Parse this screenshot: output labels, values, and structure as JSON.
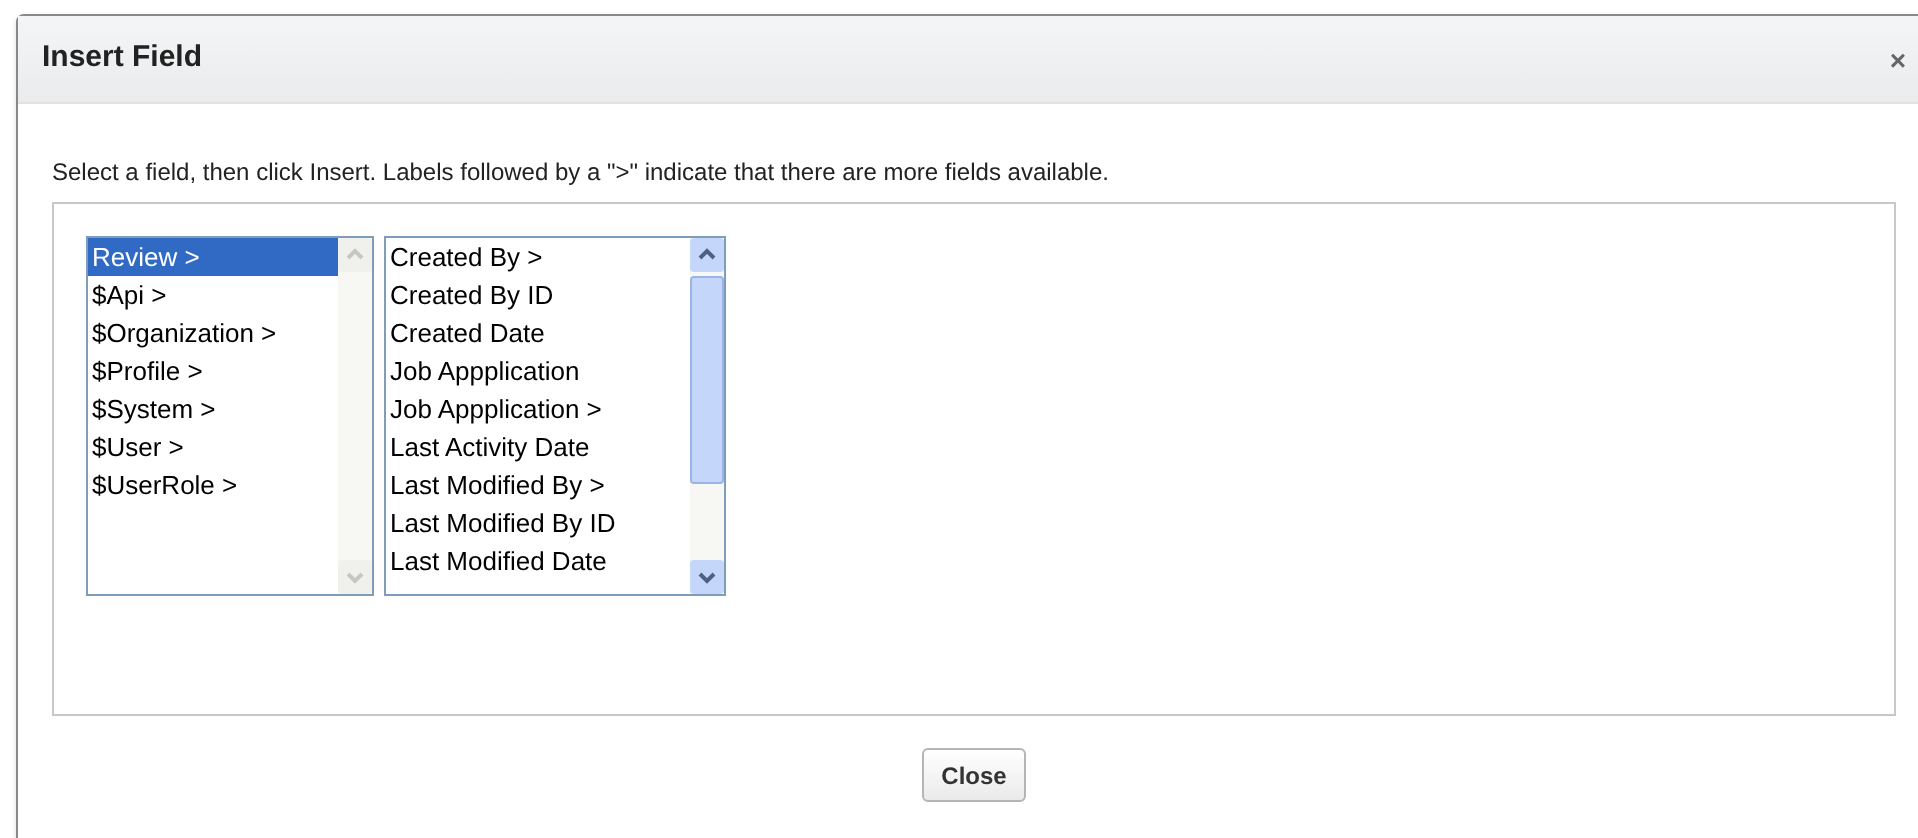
{
  "dialog": {
    "title": "Insert Field",
    "close_icon": "×"
  },
  "instructions": "Select a field, then click Insert. Labels followed by a \">\" indicate that there are more fields available.",
  "lists": [
    {
      "scrollable": false,
      "items": [
        {
          "label": "Review >",
          "selected": true
        },
        {
          "label": "$Api >",
          "selected": false
        },
        {
          "label": "$Organization >",
          "selected": false
        },
        {
          "label": "$Profile >",
          "selected": false
        },
        {
          "label": "$System >",
          "selected": false
        },
        {
          "label": "$User >",
          "selected": false
        },
        {
          "label": "$UserRole >",
          "selected": false
        }
      ]
    },
    {
      "scrollable": true,
      "items": [
        {
          "label": "Created By >",
          "selected": false
        },
        {
          "label": "Created By ID",
          "selected": false
        },
        {
          "label": "Created Date",
          "selected": false
        },
        {
          "label": "Job Appplication",
          "selected": false
        },
        {
          "label": "Job Appplication >",
          "selected": false
        },
        {
          "label": "Last Activity Date",
          "selected": false
        },
        {
          "label": "Last Modified By >",
          "selected": false
        },
        {
          "label": "Last Modified By ID",
          "selected": false
        },
        {
          "label": "Last Modified Date",
          "selected": false
        }
      ]
    }
  ],
  "buttons": [
    "Close"
  ]
}
